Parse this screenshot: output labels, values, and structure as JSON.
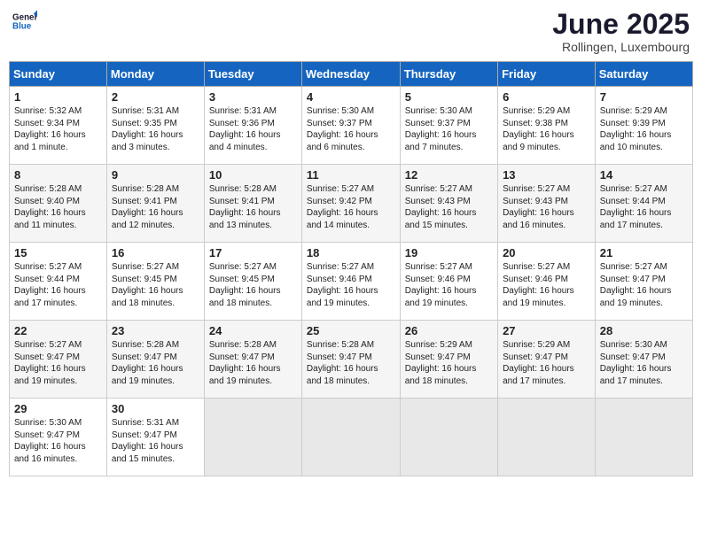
{
  "header": {
    "logo_general": "General",
    "logo_blue": "Blue",
    "title": "June 2025",
    "location": "Rollingen, Luxembourg"
  },
  "days_of_week": [
    "Sunday",
    "Monday",
    "Tuesday",
    "Wednesday",
    "Thursday",
    "Friday",
    "Saturday"
  ],
  "weeks": [
    [
      {
        "day": "1",
        "sunrise": "5:32 AM",
        "sunset": "9:34 PM",
        "daylight": "16 hours and 1 minute."
      },
      {
        "day": "2",
        "sunrise": "5:31 AM",
        "sunset": "9:35 PM",
        "daylight": "16 hours and 3 minutes."
      },
      {
        "day": "3",
        "sunrise": "5:31 AM",
        "sunset": "9:36 PM",
        "daylight": "16 hours and 4 minutes."
      },
      {
        "day": "4",
        "sunrise": "5:30 AM",
        "sunset": "9:37 PM",
        "daylight": "16 hours and 6 minutes."
      },
      {
        "day": "5",
        "sunrise": "5:30 AM",
        "sunset": "9:37 PM",
        "daylight": "16 hours and 7 minutes."
      },
      {
        "day": "6",
        "sunrise": "5:29 AM",
        "sunset": "9:38 PM",
        "daylight": "16 hours and 9 minutes."
      },
      {
        "day": "7",
        "sunrise": "5:29 AM",
        "sunset": "9:39 PM",
        "daylight": "16 hours and 10 minutes."
      }
    ],
    [
      {
        "day": "8",
        "sunrise": "5:28 AM",
        "sunset": "9:40 PM",
        "daylight": "16 hours and 11 minutes."
      },
      {
        "day": "9",
        "sunrise": "5:28 AM",
        "sunset": "9:41 PM",
        "daylight": "16 hours and 12 minutes."
      },
      {
        "day": "10",
        "sunrise": "5:28 AM",
        "sunset": "9:41 PM",
        "daylight": "16 hours and 13 minutes."
      },
      {
        "day": "11",
        "sunrise": "5:27 AM",
        "sunset": "9:42 PM",
        "daylight": "16 hours and 14 minutes."
      },
      {
        "day": "12",
        "sunrise": "5:27 AM",
        "sunset": "9:43 PM",
        "daylight": "16 hours and 15 minutes."
      },
      {
        "day": "13",
        "sunrise": "5:27 AM",
        "sunset": "9:43 PM",
        "daylight": "16 hours and 16 minutes."
      },
      {
        "day": "14",
        "sunrise": "5:27 AM",
        "sunset": "9:44 PM",
        "daylight": "16 hours and 17 minutes."
      }
    ],
    [
      {
        "day": "15",
        "sunrise": "5:27 AM",
        "sunset": "9:44 PM",
        "daylight": "16 hours and 17 minutes."
      },
      {
        "day": "16",
        "sunrise": "5:27 AM",
        "sunset": "9:45 PM",
        "daylight": "16 hours and 18 minutes."
      },
      {
        "day": "17",
        "sunrise": "5:27 AM",
        "sunset": "9:45 PM",
        "daylight": "16 hours and 18 minutes."
      },
      {
        "day": "18",
        "sunrise": "5:27 AM",
        "sunset": "9:46 PM",
        "daylight": "16 hours and 19 minutes."
      },
      {
        "day": "19",
        "sunrise": "5:27 AM",
        "sunset": "9:46 PM",
        "daylight": "16 hours and 19 minutes."
      },
      {
        "day": "20",
        "sunrise": "5:27 AM",
        "sunset": "9:46 PM",
        "daylight": "16 hours and 19 minutes."
      },
      {
        "day": "21",
        "sunrise": "5:27 AM",
        "sunset": "9:47 PM",
        "daylight": "16 hours and 19 minutes."
      }
    ],
    [
      {
        "day": "22",
        "sunrise": "5:27 AM",
        "sunset": "9:47 PM",
        "daylight": "16 hours and 19 minutes."
      },
      {
        "day": "23",
        "sunrise": "5:28 AM",
        "sunset": "9:47 PM",
        "daylight": "16 hours and 19 minutes."
      },
      {
        "day": "24",
        "sunrise": "5:28 AM",
        "sunset": "9:47 PM",
        "daylight": "16 hours and 19 minutes."
      },
      {
        "day": "25",
        "sunrise": "5:28 AM",
        "sunset": "9:47 PM",
        "daylight": "16 hours and 18 minutes."
      },
      {
        "day": "26",
        "sunrise": "5:29 AM",
        "sunset": "9:47 PM",
        "daylight": "16 hours and 18 minutes."
      },
      {
        "day": "27",
        "sunrise": "5:29 AM",
        "sunset": "9:47 PM",
        "daylight": "16 hours and 17 minutes."
      },
      {
        "day": "28",
        "sunrise": "5:30 AM",
        "sunset": "9:47 PM",
        "daylight": "16 hours and 17 minutes."
      }
    ],
    [
      {
        "day": "29",
        "sunrise": "5:30 AM",
        "sunset": "9:47 PM",
        "daylight": "16 hours and 16 minutes."
      },
      {
        "day": "30",
        "sunrise": "5:31 AM",
        "sunset": "9:47 PM",
        "daylight": "16 hours and 15 minutes."
      },
      null,
      null,
      null,
      null,
      null
    ]
  ],
  "labels": {
    "sunrise_prefix": "Sunrise: ",
    "sunset_prefix": "Sunset: ",
    "daylight_prefix": "Daylight: "
  }
}
